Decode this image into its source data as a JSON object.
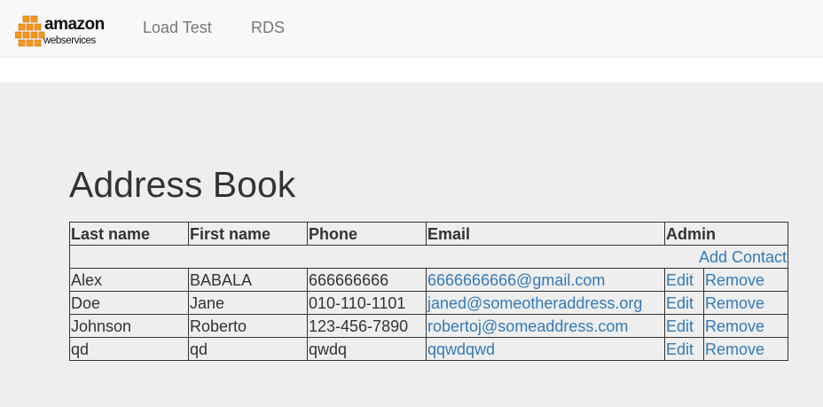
{
  "nav": {
    "logo": {
      "word": "amazon",
      "sub": "webservices"
    },
    "links": [
      {
        "label": "Load Test"
      },
      {
        "label": "RDS"
      }
    ]
  },
  "page": {
    "title": "Address Book"
  },
  "table": {
    "headers": {
      "last_name": "Last name",
      "first_name": "First name",
      "phone": "Phone",
      "email": "Email",
      "admin": "Admin"
    },
    "add_contact_label": "Add Contact",
    "edit_label": "Edit",
    "remove_label": "Remove",
    "rows": [
      {
        "last": "Alex",
        "first": "BABALA",
        "phone": "666666666",
        "email": "6666666666@gmail.com"
      },
      {
        "last": "Doe",
        "first": "Jane",
        "phone": "010-110-1101",
        "email": "janed@someotheraddress.org"
      },
      {
        "last": "Johnson",
        "first": "Roberto",
        "phone": "123-456-7890",
        "email": "robertoj@someaddress.com"
      },
      {
        "last": "qd",
        "first": "qd",
        "phone": "qwdq",
        "email": "qqwdqwd"
      }
    ]
  },
  "colors": {
    "link": "#337ab7",
    "logo_orange": "#f7981d",
    "background": "#eeeeee",
    "navbar": "#f8f8f8"
  }
}
